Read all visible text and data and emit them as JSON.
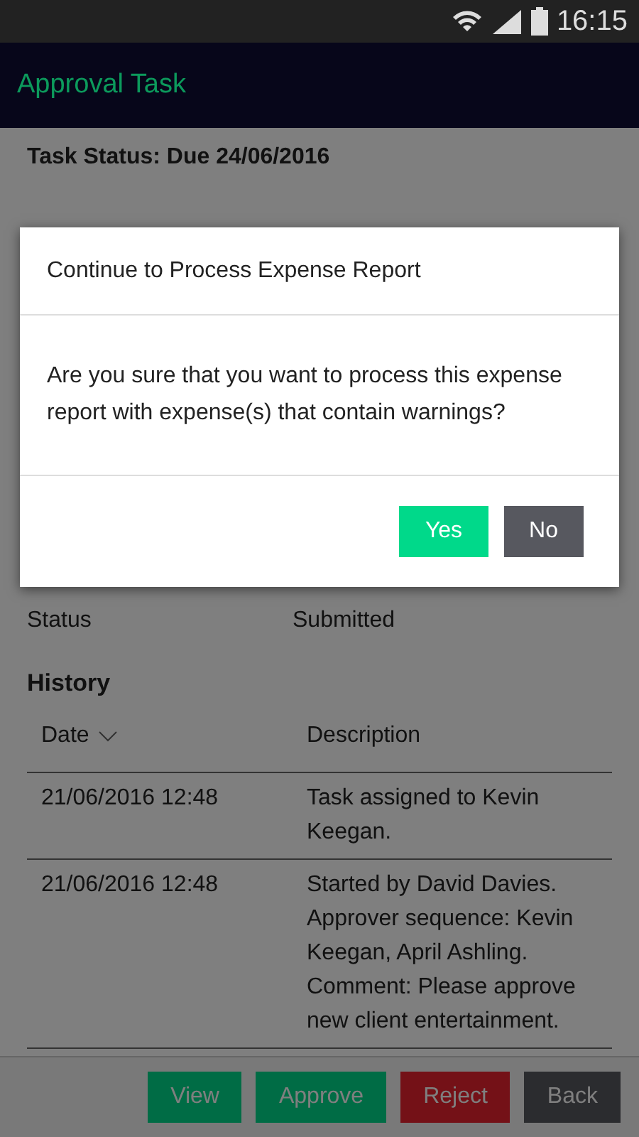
{
  "status_bar": {
    "time": "16:15"
  },
  "app_bar": {
    "title": "Approval Task"
  },
  "task_status": "Task Status: Due 24/06/2016",
  "fields": [
    {
      "label": "Status",
      "value": "Submitted"
    }
  ],
  "history": {
    "title": "History",
    "columns": [
      "Date",
      "Description"
    ],
    "rows": [
      {
        "date": "21/06/2016 12:48",
        "description": "Task assigned to Kevin Keegan."
      },
      {
        "date": "21/06/2016 12:48",
        "description": "Started by David Davies. Approver sequence: Kevin Keegan, April Ashling. Comment: Please approve new client entertainment."
      }
    ]
  },
  "actions": [
    {
      "label": "View",
      "kind": "primary"
    },
    {
      "label": "Approve",
      "kind": "primary"
    },
    {
      "label": "Reject",
      "kind": "danger"
    },
    {
      "label": "Back",
      "kind": "neutral"
    }
  ],
  "dialog": {
    "title": "Continue to Process Expense Report",
    "message": "Are you sure that you want to process this expense report with expense(s) that contain warnings?",
    "buttons": [
      {
        "label": "Yes",
        "kind": "primary"
      },
      {
        "label": "No",
        "kind": "neutral"
      }
    ]
  }
}
